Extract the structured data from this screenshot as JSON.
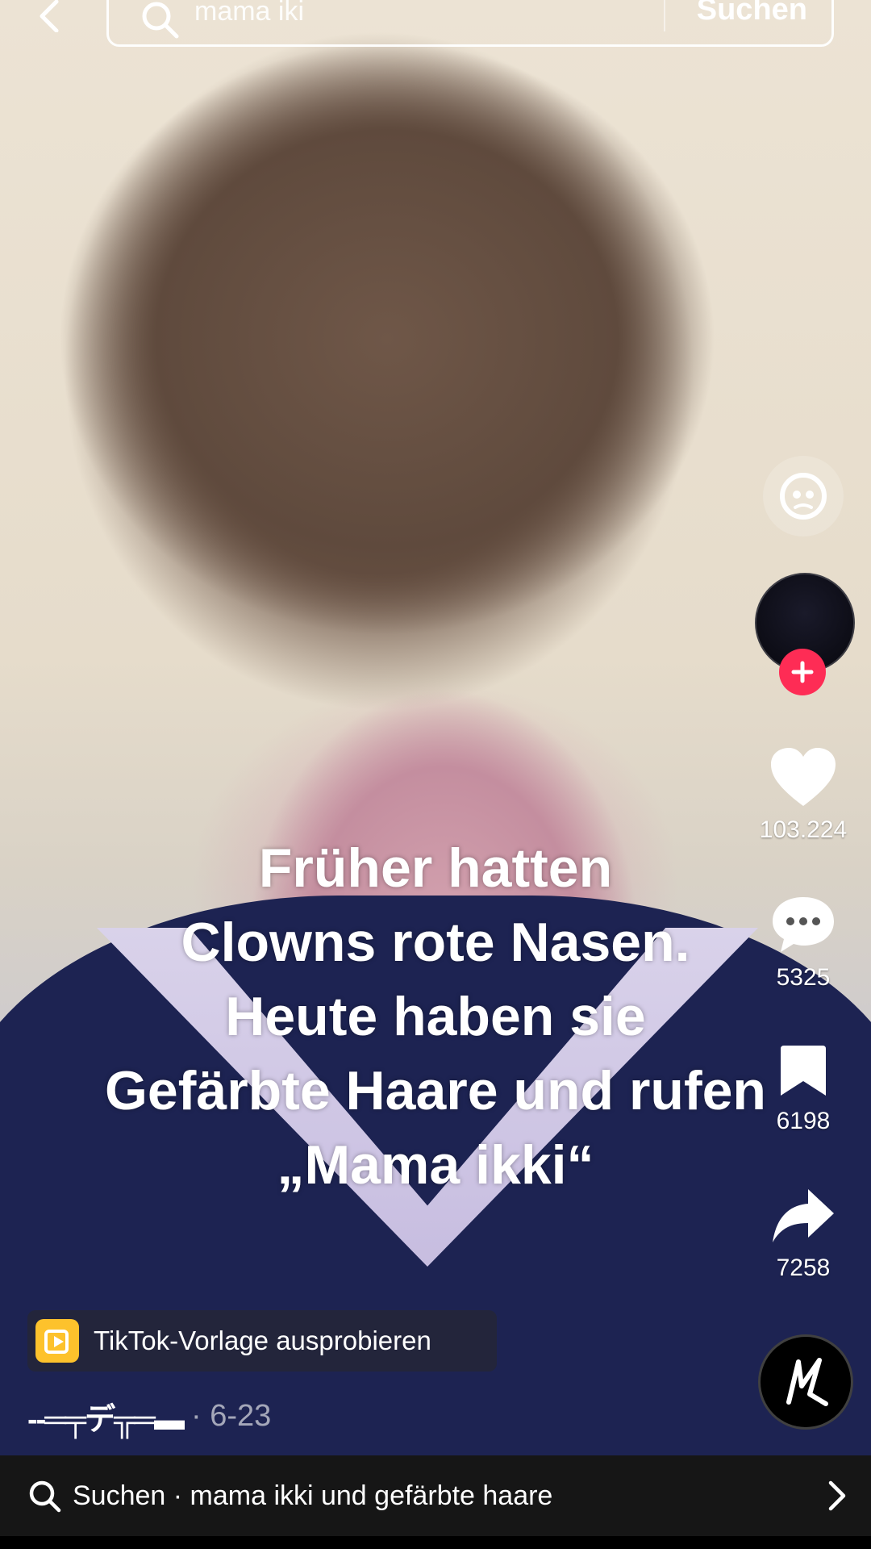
{
  "search": {
    "query": "mama iki",
    "submit_label": "Suchen"
  },
  "caption": {
    "lines": [
      "Früher hatten",
      "Clowns rote Nasen.",
      "Heute haben sie",
      "Gefärbte Haare und rufen",
      "„Mama ikki“"
    ]
  },
  "rail": {
    "likes": "103.224",
    "comments": "5325",
    "saves": "6198",
    "shares": "7258"
  },
  "template_chip": {
    "label": "TikTok-Vorlage ausprobieren"
  },
  "post": {
    "handle": "--═╤デ╦═▬",
    "date": "· 6-23"
  },
  "suggestion": {
    "text": "Suchen · mama ikki und gefärbte haare"
  },
  "colors": {
    "follow_plus": "#fe2c55",
    "template_icon": "#fdc22c",
    "suggest_bar": "#161616"
  },
  "icons": [
    "back-arrow-icon",
    "search-icon",
    "sticker-face-icon",
    "plus-icon",
    "heart-icon",
    "comment-icon",
    "bookmark-icon",
    "share-icon",
    "template-icon",
    "chevron-right-icon"
  ]
}
